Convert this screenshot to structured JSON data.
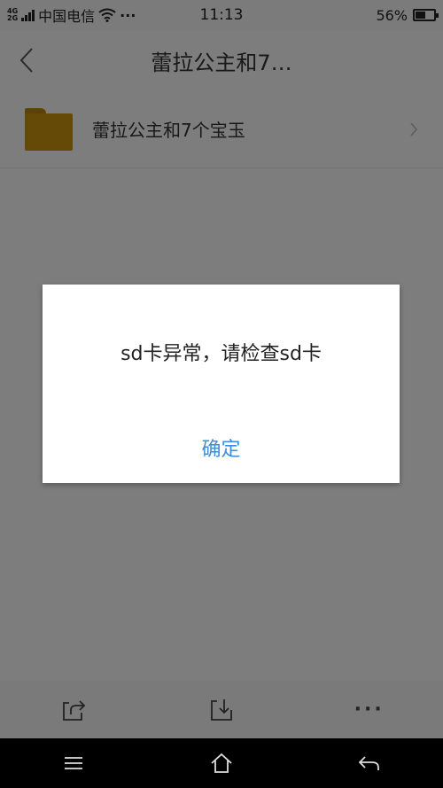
{
  "status_bar": {
    "network_type_top": "4G",
    "network_type_bottom": "2G",
    "carrier": "中国电信",
    "more": "···",
    "time": "11:13",
    "battery_percent": "56%",
    "battery_level": 0.56
  },
  "title_bar": {
    "title": "蕾拉公主和7…"
  },
  "list": {
    "items": [
      {
        "label": "蕾拉公主和7个宝玉"
      }
    ]
  },
  "dialog": {
    "message": "sd卡异常，请检查sd卡",
    "confirm_label": "确定"
  },
  "toolbar": {
    "more_label": "···"
  },
  "colors": {
    "accent": "#3a8ee6",
    "folder": "#c9950c"
  }
}
